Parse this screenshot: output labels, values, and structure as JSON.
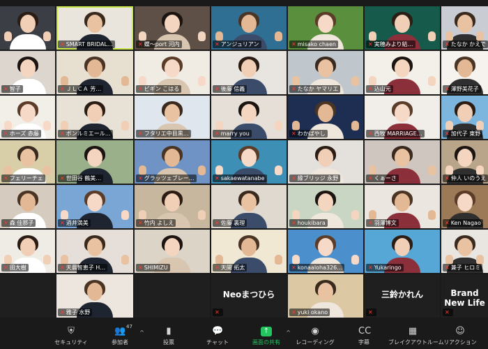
{
  "colors": {
    "active_outline": "#c9e84a",
    "mic_muted": "#ff3b30",
    "share_green": "#22c55e"
  },
  "tiles": [
    {
      "label": "",
      "bg": "#3b3f45"
    },
    {
      "label": "SMART BRIDAL…",
      "bg": "#e9e4dc",
      "active": true
    },
    {
      "label": "蝶〜port 河内",
      "bg": "#5e5046"
    },
    {
      "label": "アンジュリアン",
      "bg": "#2f6f93"
    },
    {
      "label": "misako chaen",
      "bg": "#5a8f3e"
    },
    {
      "label": "実穂みより結…",
      "bg": "#155a4a"
    },
    {
      "label": "たなか かえで",
      "bg": "#c9cdd3"
    },
    {
      "label": "智子",
      "bg": "#ddd6cf"
    },
    {
      "label": "ＪＬＣＡ 芳…",
      "bg": "#e7dfd0"
    },
    {
      "label": "ビギン こはる",
      "bg": "#f0ebe3"
    },
    {
      "label": "後藤 信義",
      "bg": "#e8e5e0"
    },
    {
      "label": "たなか ヤマリエ",
      "bg": "#bfc6cc"
    },
    {
      "label": "込山元",
      "bg": "#f3f0ea"
    },
    {
      "label": "澤野美花子",
      "bg": "#f6f3ee"
    },
    {
      "label": "ホーズ 赤藤",
      "bg": "#f2eee8"
    },
    {
      "label": "ボンルミエール…",
      "bg": "#e8e2d6"
    },
    {
      "label": "フタリエ中目黒…",
      "bg": "#dfe6ee"
    },
    {
      "label": "marry you",
      "bg": "#e6dfd8"
    },
    {
      "label": "わかばやし",
      "bg": "#1d2e52"
    },
    {
      "label": "西牧 MARRIAGE…",
      "bg": "#f1eee9"
    },
    {
      "label": "加代子 東野",
      "bg": "#7cb6df"
    },
    {
      "label": "フェリーチェ",
      "bg": "#d8cfa8"
    },
    {
      "label": "世田谷 鶴美…",
      "bg": "#9ab08a"
    },
    {
      "label": "グラッツェブレー…",
      "bg": "#6e93c4"
    },
    {
      "label": "sakaewatanabe",
      "bg": "#3d8fb5"
    },
    {
      "label": "縁ブリッジ 永野",
      "bg": "#e4e1dc"
    },
    {
      "label": "くぁーさ",
      "bg": "#cfc7bf"
    },
    {
      "label": "仲人 いのうえ",
      "bg": "#b9a58a"
    },
    {
      "label": "森 佳那子",
      "bg": "#d5ccbf"
    },
    {
      "label": "酒井満美",
      "bg": "#7aa6d6"
    },
    {
      "label": "竹内 よしえ",
      "bg": "#c8b79f"
    },
    {
      "label": "佐藤 裏理",
      "bg": "#e0d9cf"
    },
    {
      "label": "houkibara",
      "bg": "#c9d6c4"
    },
    {
      "label": "羽澤博文",
      "bg": "#ebe7e0"
    },
    {
      "label": "Ken Nagao",
      "bg": "#9c7a58"
    },
    {
      "label": "田大樹",
      "bg": "#efece6"
    },
    {
      "label": "天晨智恵子 H…",
      "bg": "#e6ded8"
    },
    {
      "label": "SHIMIZU",
      "bg": "#dcd4c6"
    },
    {
      "label": "天開 拓太",
      "bg": "#f0e8d2"
    },
    {
      "label": "konaaloha326…",
      "bg": "#4c8fcd"
    },
    {
      "label": "Yukaringo",
      "bg": "#56a6d6"
    },
    {
      "label": "兼子 ヒロミ",
      "bg": "#e9e6e2"
    },
    {
      "label": "",
      "bg": "#1f1f1f"
    },
    {
      "label": "雅子 水野",
      "bg": "#ece6df"
    },
    {
      "label": "",
      "bg": "#1f1f1f"
    },
    {
      "label": "",
      "bg": "#1f1f1f",
      "text_name": "Neoまつひら"
    },
    {
      "label": "yuki okano",
      "bg": "#dcc9a4"
    },
    {
      "label": "",
      "bg": "#1f1f1f",
      "text_name": "三鈴かれん"
    },
    {
      "label": "",
      "bg": "#1f1f1f",
      "text_name": "Brand New Life"
    }
  ],
  "toolbar": {
    "participant_count": "47",
    "items": [
      {
        "label": "セキュリティ",
        "icon": "shield-icon",
        "glyph": "⛨"
      },
      {
        "label": "参加者",
        "icon": "participants-icon",
        "glyph": "👥"
      },
      {
        "label": "投票",
        "icon": "polls-icon",
        "glyph": "▮"
      },
      {
        "label": "チャット",
        "icon": "chat-icon",
        "glyph": "💬"
      },
      {
        "label": "画面の共有",
        "icon": "share-screen-icon",
        "glyph": "↑"
      },
      {
        "label": "レコーディング",
        "icon": "record-icon",
        "glyph": "◉"
      },
      {
        "label": "字幕",
        "icon": "captions-icon",
        "glyph": "CC"
      },
      {
        "label": "ブレイクアウトルーム",
        "icon": "breakout-rooms-icon",
        "glyph": "▦"
      },
      {
        "label": "リアクション",
        "icon": "reactions-icon",
        "glyph": "☺"
      }
    ]
  }
}
